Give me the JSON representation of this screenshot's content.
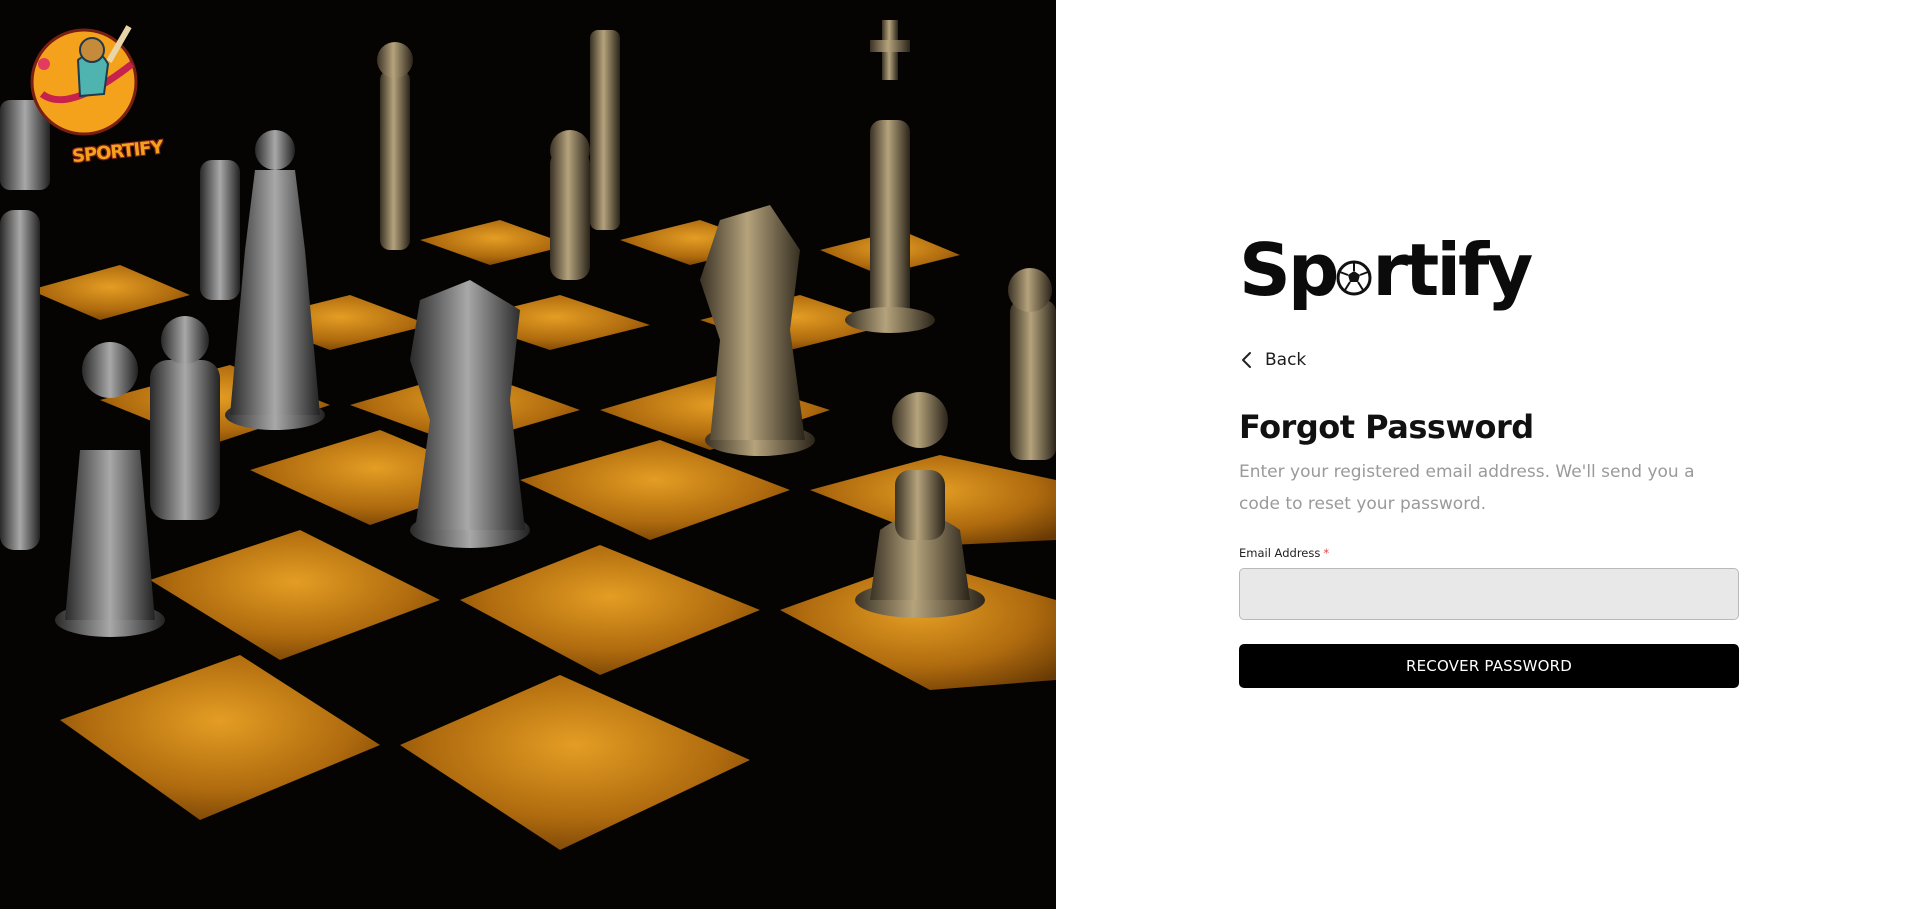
{
  "hero": {
    "corner_logo_text": "SPORTIFY",
    "colors": {
      "board_light": "#d08a1a",
      "board_dark": "#050403",
      "piece": "#8a7a5e"
    }
  },
  "brand": {
    "name_before": "Sp",
    "name_after": "rtify",
    "icon": "soccer-ball-icon"
  },
  "back": {
    "label": "Back",
    "icon": "chevron-left-icon"
  },
  "form": {
    "title": "Forgot Password",
    "subtitle": "Enter your registered email address. We'll send you a code to reset your password.",
    "email_label": "Email Address",
    "required_mark": "*",
    "email_value": "",
    "submit_label": "RECOVER PASSWORD"
  },
  "colors": {
    "button_bg": "#000000",
    "input_bg": "#e8e8e8",
    "required": "#e04545",
    "muted_text": "#9a9a9a"
  }
}
